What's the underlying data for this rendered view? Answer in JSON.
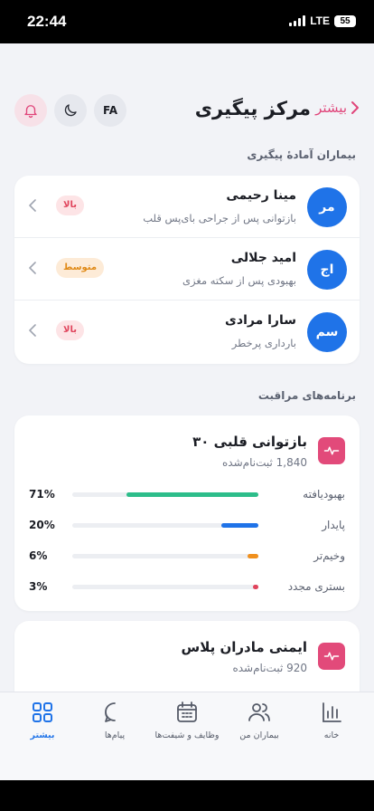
{
  "status_bar": {
    "time": "22:44",
    "network": "LTE",
    "battery": "55"
  },
  "header": {
    "title": "مرکز پیگیری",
    "back_label": "بیشتر",
    "lang_label": "FA",
    "theme_icon": "moon-icon",
    "bell_icon": "bell-icon",
    "accent_color": "#e0457a"
  },
  "patients_section": {
    "title": "بیماران آمادهٔ پیگیری",
    "items": [
      {
        "initials": "مر",
        "name": "مینا رحیمی",
        "desc": "بازتوانی پس از جراحی بای‌پس قلب",
        "risk": "بالا"
      },
      {
        "initials": "اج",
        "name": "امید جلالی",
        "desc": "بهبودی پس از سکته مغزی",
        "risk": "متوسط"
      },
      {
        "initials": "سم",
        "name": "سارا مرادی",
        "desc": "بارداری پرخطر",
        "risk": "بالا"
      }
    ]
  },
  "programs_section": {
    "title": "برنامه‌های مراقبت",
    "programs": [
      {
        "title": "بازتوانی قلبی ۳۰",
        "enrolled": "1,840 ثبت‌نام‌شده",
        "icon": "pulse-icon",
        "stats": [
          {
            "label": "بهبودیافته",
            "pct": "71%",
            "value": 0.71,
            "color": "#2dbd8a"
          },
          {
            "label": "پایدار",
            "pct": "20%",
            "value": 0.2,
            "color": "#1f73e8"
          },
          {
            "label": "وخیم‌تر",
            "pct": "6%",
            "value": 0.06,
            "color": "#f0901e"
          },
          {
            "label": "بستری مجدد",
            "pct": "3%",
            "value": 0.03,
            "color": "#e0445c"
          }
        ]
      },
      {
        "title": "ایمنی مادران پلاس",
        "enrolled": "920 ثبت‌نام‌شده",
        "icon": "pulse-icon"
      }
    ]
  },
  "tabbar": {
    "tabs": [
      {
        "label": "خانه",
        "icon": "bar-chart-icon"
      },
      {
        "label": "بیماران من",
        "icon": "users-icon"
      },
      {
        "label": "وظایف و شیفت‌ها",
        "icon": "calendar-icon"
      },
      {
        "label": "پیام‌ها",
        "icon": "chat-icon"
      },
      {
        "label": "بیشتر",
        "icon": "grid-icon",
        "active": true
      }
    ]
  }
}
